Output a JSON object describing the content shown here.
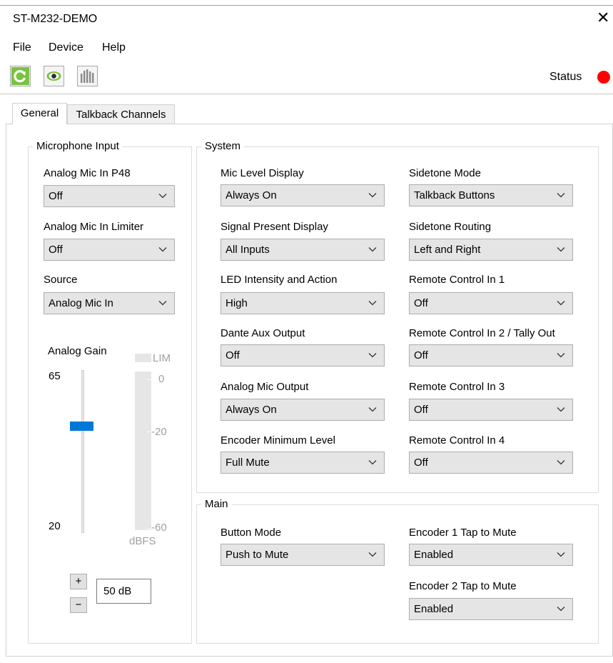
{
  "window": {
    "title": "ST-M232-DEMO",
    "close_glyph": "✕"
  },
  "menu": {
    "file": "File",
    "device": "Device",
    "help": "Help"
  },
  "toolbar": {
    "refresh_icon": "refresh-icon",
    "eye_icon": "eye-icon",
    "meter_icon": "meter-bars-icon",
    "status_label": "Status",
    "status_color": "#ff0000"
  },
  "tabs": {
    "general": "General",
    "talkback": "Talkback Channels"
  },
  "mic_input": {
    "legend": "Microphone Input",
    "p48_label": "Analog Mic In P48",
    "p48_value": "Off",
    "limiter_label": "Analog Mic In Limiter",
    "limiter_value": "Off",
    "source_label": "Source",
    "source_value": "Analog Mic In",
    "gain_label": "Analog Gain",
    "gain_max": "65",
    "gain_min": "20",
    "gain_fraction": 0.667,
    "lim_label": "LIM",
    "meter_top": "0",
    "meter_mid": "-20",
    "meter_bot": "-60",
    "meter_unit": "dBFS",
    "plus": "+",
    "minus": "−",
    "gain_value": "50 dB"
  },
  "system": {
    "legend": "System",
    "mic_level_label": "Mic Level Display",
    "mic_level_value": "Always On",
    "signal_label": "Signal Present Display",
    "signal_value": "All Inputs",
    "led_label": "LED Intensity and Action",
    "led_value": "High",
    "dante_label": "Dante Aux Output",
    "dante_value": "Off",
    "analog_out_label": "Analog Mic Output",
    "analog_out_value": "Always On",
    "encoder_min_label": "Encoder Minimum Level",
    "encoder_min_value": "Full Mute",
    "sidetone_mode_label": "Sidetone Mode",
    "sidetone_mode_value": "Talkback Buttons",
    "sidetone_routing_label": "Sidetone Routing",
    "sidetone_routing_value": "Left and Right",
    "rc1_label": "Remote Control In 1",
    "rc1_value": "Off",
    "rc2_label": "Remote Control In 2 / Tally Out",
    "rc2_value": "Off",
    "rc3_label": "Remote Control In 3",
    "rc3_value": "Off",
    "rc4_label": "Remote Control In 4",
    "rc4_value": "Off"
  },
  "main": {
    "legend": "Main",
    "button_mode_label": "Button Mode",
    "button_mode_value": "Push to Mute",
    "enc1_label": "Encoder 1 Tap to Mute",
    "enc1_value": "Enabled",
    "enc2_label": "Encoder 2 Tap to Mute",
    "enc2_value": "Enabled"
  }
}
